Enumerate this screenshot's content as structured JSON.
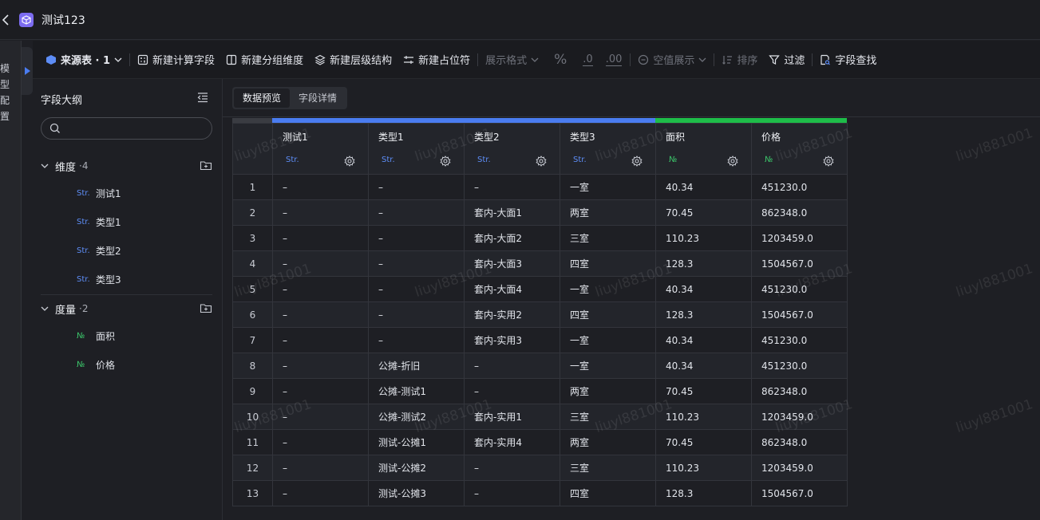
{
  "app": {
    "title": "测试123"
  },
  "rail": {
    "label": "模型配置"
  },
  "toolbar": {
    "source_label": "来源表 · 1",
    "new_calc_field": "新建计算字段",
    "new_group_dim": "新建分组维度",
    "new_hierarchy": "新建层级结构",
    "new_placeholder": "新建占位符",
    "display_format": "展示格式",
    "percent_symbol": "%",
    "decimal_one": ".0",
    "decimal_two": ".00",
    "null_display": "空值展示",
    "sort": "排序",
    "filter": "过滤",
    "field_search": "字段查找"
  },
  "sidebar": {
    "title": "字段大纲",
    "search_placeholder": "",
    "dimensions": {
      "label": "维度",
      "count": "·4",
      "items": [
        {
          "type": "Str.",
          "name": "测试1"
        },
        {
          "type": "Str.",
          "name": "类型1"
        },
        {
          "type": "Str.",
          "name": "类型2"
        },
        {
          "type": "Str.",
          "name": "类型3"
        }
      ]
    },
    "measures": {
      "label": "度量",
      "count": "·2",
      "items": [
        {
          "type": "№",
          "name": "面积"
        },
        {
          "type": "№",
          "name": "价格"
        }
      ]
    }
  },
  "tabs": {
    "preview": "数据预览",
    "detail": "字段详情"
  },
  "colors": {
    "dimension": "#4a7cf0",
    "measure": "#1ebd49"
  },
  "table": {
    "columns": [
      {
        "name": "测试1",
        "type": "Str.",
        "kind": "dim"
      },
      {
        "name": "类型1",
        "type": "Str.",
        "kind": "dim"
      },
      {
        "name": "类型2",
        "type": "Str.",
        "kind": "dim"
      },
      {
        "name": "类型3",
        "type": "Str.",
        "kind": "dim"
      },
      {
        "name": "面积",
        "type": "№",
        "kind": "measure"
      },
      {
        "name": "价格",
        "type": "№",
        "kind": "measure"
      }
    ],
    "rows": [
      [
        "1",
        "–",
        "–",
        "–",
        "一室",
        "40.34",
        "451230.0"
      ],
      [
        "2",
        "–",
        "–",
        "套内-大面1",
        "两室",
        "70.45",
        "862348.0"
      ],
      [
        "3",
        "–",
        "–",
        "套内-大面2",
        "三室",
        "110.23",
        "1203459.0"
      ],
      [
        "4",
        "–",
        "–",
        "套内-大面3",
        "四室",
        "128.3",
        "1504567.0"
      ],
      [
        "5",
        "–",
        "–",
        "套内-大面4",
        "一室",
        "40.34",
        "451230.0"
      ],
      [
        "6",
        "–",
        "–",
        "套内-实用2",
        "四室",
        "128.3",
        "1504567.0"
      ],
      [
        "7",
        "–",
        "–",
        "套内-实用3",
        "一室",
        "40.34",
        "451230.0"
      ],
      [
        "8",
        "–",
        "公摊-折旧",
        "–",
        "一室",
        "40.34",
        "451230.0"
      ],
      [
        "9",
        "–",
        "公摊-测试1",
        "–",
        "两室",
        "70.45",
        "862348.0"
      ],
      [
        "10",
        "–",
        "公摊-测试2",
        "套内-实用1",
        "三室",
        "110.23",
        "1203459.0"
      ],
      [
        "11",
        "–",
        "测试-公摊1",
        "套内-实用4",
        "两室",
        "70.45",
        "862348.0"
      ],
      [
        "12",
        "–",
        "测试-公摊2",
        "–",
        "三室",
        "110.23",
        "1203459.0"
      ],
      [
        "13",
        "–",
        "测试-公摊3",
        "–",
        "四室",
        "128.3",
        "1504567.0"
      ]
    ]
  },
  "watermark": "liuyl881001"
}
